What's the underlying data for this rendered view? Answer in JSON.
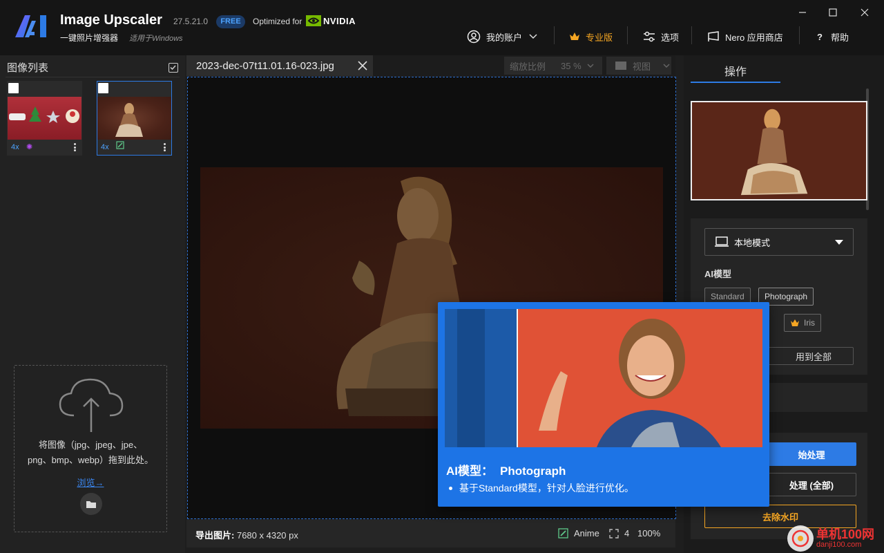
{
  "app": {
    "title": "Image Upscaler",
    "version": "27.5.21.0",
    "badge": "FREE",
    "optimized_for": "Optimized for",
    "gpu_brand": "NVIDIA",
    "subtitle": "一键照片增强器",
    "subtitle_note": "适用于Windows"
  },
  "topnav": {
    "account": "我的账户",
    "pro": "专业版",
    "options": "选项",
    "store": "Nero 应用商店",
    "help": "帮助"
  },
  "colors": {
    "accent": "#2d7be5",
    "pro_gold": "#f5a623",
    "nvidia_green": "#76b900"
  },
  "left_panel": {
    "title": "图像列表",
    "thumbnails": [
      {
        "scale": "4x",
        "model_icon": "sparkle-icon",
        "selected": false
      },
      {
        "scale": "4x",
        "model_icon": "photo-edit-icon",
        "selected": true
      }
    ],
    "dropzone": {
      "line1": "将图像（jpg、jpeg、jpe、",
      "line2": "png、bmp、webp）拖到此处。",
      "browse": "浏览→"
    }
  },
  "center": {
    "tab_name": "2023-dec-07t11.01.16-023.jpg",
    "zoom_label": "缩放比例",
    "zoom_value": "35 %",
    "view_label": "视图",
    "status": {
      "export_label": "导出图片:",
      "export_size": "7680 x 4320 px",
      "model": "Anime",
      "factor": "4",
      "percent": "100%"
    }
  },
  "right_panel": {
    "tab": "操作",
    "mode": "本地模式",
    "ai_label": "AI模型",
    "models": [
      "Standard",
      "Photograph",
      "Iris"
    ],
    "apply_all": "用到全部",
    "start": "始处理",
    "process_all": "处理 (全部)",
    "remove_watermark": "去除水印"
  },
  "tooltip": {
    "title_prefix": "AI模型：",
    "title_model": "Photograph",
    "bullet": "基于Standard模型，针对人脸进行优化。"
  },
  "watermark": {
    "line1": "单机100网",
    "line2": "danji100.com"
  }
}
